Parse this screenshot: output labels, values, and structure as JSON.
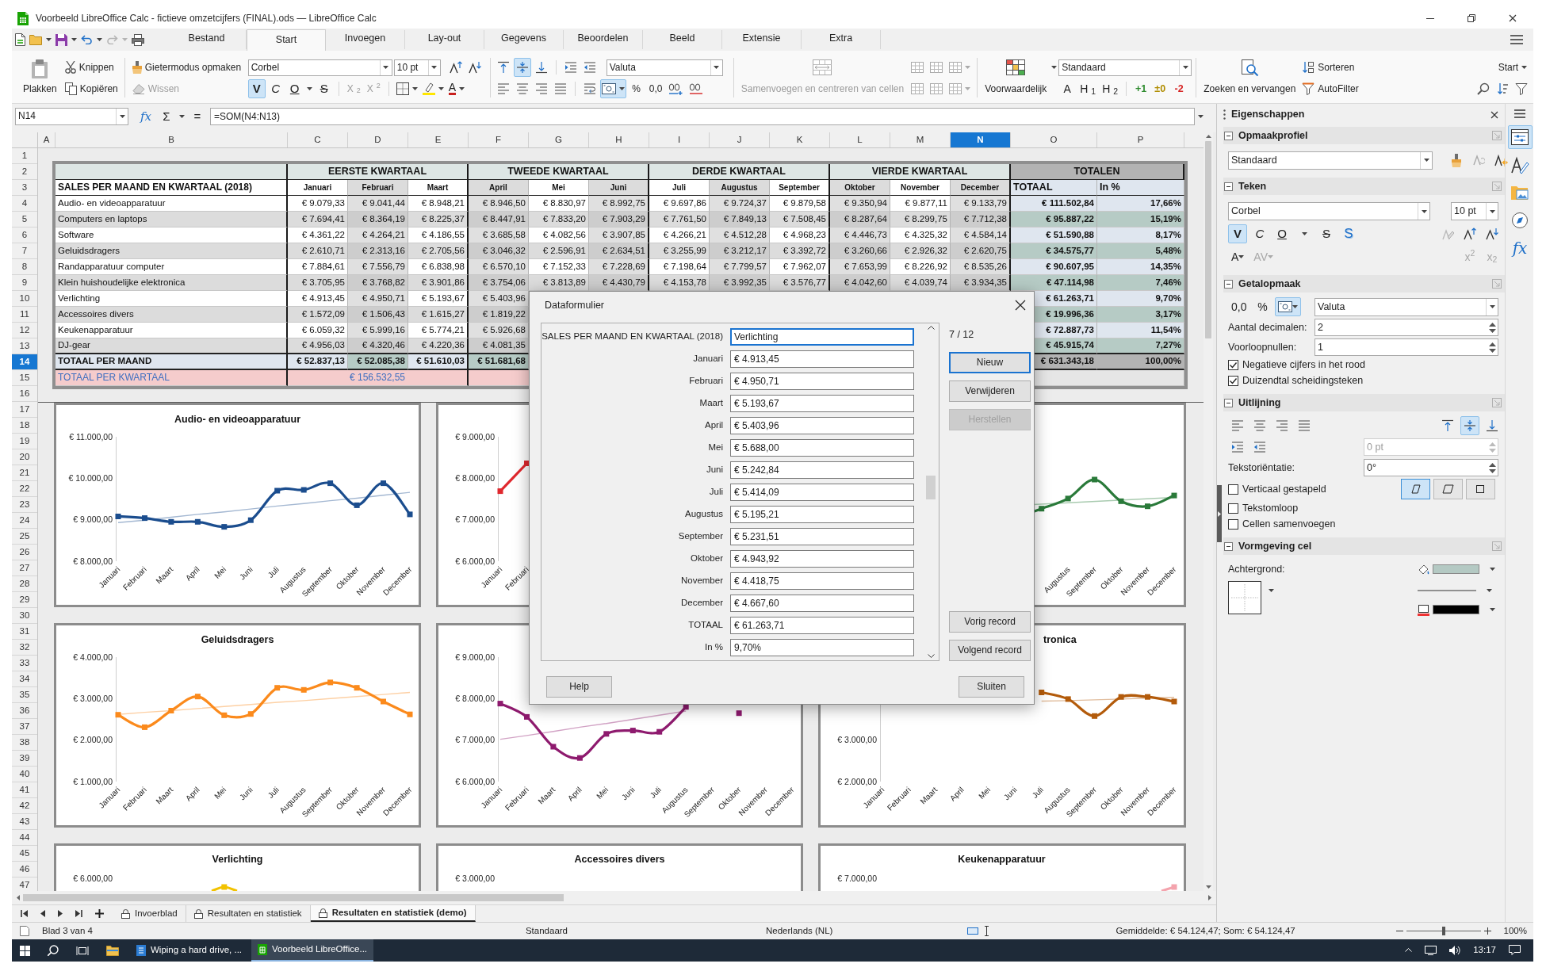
{
  "window": {
    "title": "Voorbeeld LibreOffice Calc - fictieve omzetcijfers (FINAL).ods — LibreOffice Calc"
  },
  "undo": {
    "disabled": false
  },
  "redo": {
    "disabled": true
  },
  "menu_tabs": [
    {
      "label": "Bestand",
      "selected": false
    },
    {
      "label": "Start",
      "selected": true
    },
    {
      "label": "Invoegen",
      "selected": false
    },
    {
      "label": "Lay-out",
      "selected": false
    },
    {
      "label": "Gegevens",
      "selected": false
    },
    {
      "label": "Beoordelen",
      "selected": false
    },
    {
      "label": "Beeld",
      "selected": false
    },
    {
      "label": "Extensie",
      "selected": false
    },
    {
      "label": "Extra",
      "selected": false
    }
  ],
  "ribbon": {
    "paste": "Plakken",
    "cut": "Knippen",
    "copy": "Kopiëren",
    "clone": "Gietermodus opmaken",
    "clear": {
      "label": "Wissen",
      "disabled": true
    },
    "font": "Corbel",
    "size": "10 pt",
    "styles": [
      {
        "label": "V",
        "on": true
      },
      {
        "label": "C",
        "on": false
      },
      {
        "label": "O",
        "on": false
      },
      {
        "label": "S",
        "on": false
      }
    ],
    "scripts": [
      {
        "label": "X$_{2}$",
        "disabled": true
      },
      {
        "label": "X$^{2}$",
        "disabled": true
      }
    ],
    "font_color": "A",
    "valign": [
      {
        "selected": false
      },
      {
        "selected": true
      },
      {
        "selected": false
      }
    ],
    "number_format": "Valuta",
    "currency": {
      "on": true
    },
    "number_symbols": [
      "%",
      "0,0"
    ],
    "merge": {
      "label": "Samenvoegen en centreren van cellen",
      "disabled": true
    },
    "conditional": "Voorwaardelijk",
    "cell_style": "Standaard",
    "style_glyphs": [
      "A",
      "H$_{1}$",
      "H$_{2}$"
    ],
    "quick_styles": [
      {
        "label": "+1",
        "color": "#2e8b2e"
      },
      {
        "label": "±0",
        "color": "#b08d00"
      },
      {
        "label": "-2",
        "color": "#d62424"
      }
    ],
    "find": "Zoeken en vervangen",
    "sort": "Sorteren",
    "filter": "AutoFilter",
    "tab_menu": "Start"
  },
  "formula_bar": {
    "cell": "N14",
    "function_wizard": "fx",
    "sum": "Σ",
    "equals": "=",
    "formula": "=SOM(N4:N13)"
  },
  "sheet": {
    "columns": [
      {
        "label": "A",
        "selected": false
      },
      {
        "label": "B",
        "selected": false
      },
      {
        "label": "C",
        "selected": false
      },
      {
        "label": "D",
        "selected": false
      },
      {
        "label": "E",
        "selected": false
      },
      {
        "label": "F",
        "selected": false
      },
      {
        "label": "G",
        "selected": false
      },
      {
        "label": "H",
        "selected": false
      },
      {
        "label": "I",
        "selected": false
      },
      {
        "label": "J",
        "selected": false
      },
      {
        "label": "K",
        "selected": false
      },
      {
        "label": "L",
        "selected": false
      },
      {
        "label": "M",
        "selected": false
      },
      {
        "label": "N",
        "selected": true
      },
      {
        "label": "O",
        "selected": false
      },
      {
        "label": "P",
        "selected": false
      }
    ],
    "rows": [
      {
        "label": "1",
        "selected": false
      },
      {
        "label": "2",
        "selected": false
      },
      {
        "label": "3",
        "selected": false
      },
      {
        "label": "4",
        "selected": false
      },
      {
        "label": "5",
        "selected": false
      },
      {
        "label": "6",
        "selected": false
      },
      {
        "label": "7",
        "selected": false
      },
      {
        "label": "8",
        "selected": false
      },
      {
        "label": "9",
        "selected": false
      },
      {
        "label": "10",
        "selected": false
      },
      {
        "label": "11",
        "selected": false
      },
      {
        "label": "12",
        "selected": false
      },
      {
        "label": "13",
        "selected": false
      },
      {
        "label": "14",
        "selected": true
      },
      {
        "label": "15",
        "selected": false
      },
      {
        "label": "16",
        "selected": false
      },
      {
        "label": "17",
        "selected": false
      },
      {
        "label": "18",
        "selected": false
      },
      {
        "label": "19",
        "selected": false
      },
      {
        "label": "20",
        "selected": false
      },
      {
        "label": "21",
        "selected": false
      },
      {
        "label": "22",
        "selected": false
      },
      {
        "label": "23",
        "selected": false
      },
      {
        "label": "24",
        "selected": false
      },
      {
        "label": "25",
        "selected": false
      },
      {
        "label": "26",
        "selected": false
      },
      {
        "label": "27",
        "selected": false
      },
      {
        "label": "28",
        "selected": false
      },
      {
        "label": "29",
        "selected": false
      },
      {
        "label": "30",
        "selected": false
      },
      {
        "label": "31",
        "selected": false
      },
      {
        "label": "32",
        "selected": false
      },
      {
        "label": "33",
        "selected": false
      },
      {
        "label": "34",
        "selected": false
      },
      {
        "label": "35",
        "selected": false
      },
      {
        "label": "36",
        "selected": false
      },
      {
        "label": "37",
        "selected": false
      },
      {
        "label": "38",
        "selected": false
      },
      {
        "label": "39",
        "selected": false
      },
      {
        "label": "40",
        "selected": false
      },
      {
        "label": "41",
        "selected": false
      },
      {
        "label": "42",
        "selected": false
      },
      {
        "label": "43",
        "selected": false
      },
      {
        "label": "44",
        "selected": false
      },
      {
        "label": "45",
        "selected": false
      },
      {
        "label": "46",
        "selected": false
      },
      {
        "label": "47",
        "selected": false
      }
    ],
    "table": {
      "group_headers": [
        {
          "kind": "quarter",
          "label": "EERSTE KWARTAAL"
        },
        {
          "kind": "quarter",
          "label": "TWEEDE KWARTAAL"
        },
        {
          "kind": "quarter",
          "label": "DERDE KWARTAAL"
        },
        {
          "kind": "quarter",
          "label": "VIERDE KWARTAAL"
        },
        {
          "kind": "totals",
          "label": "TOTALEN"
        }
      ],
      "title": "SALES PER MAAND EN KWARTAAL (2018)",
      "months": [
        "Januari",
        "Februari",
        "Maart",
        "April",
        "Mei",
        "Juni",
        "Juli",
        "Augustus",
        "September",
        "Oktober",
        "November",
        "December"
      ],
      "total_header": "TOTAAL",
      "percent_header": "In %",
      "rows": [
        {
          "label": "Audio- en videoapparatuur",
          "values": [
            "€ 9.079,33",
            "€ 9.041,44",
            "€ 8.948,21",
            "€ 8.946,50",
            "€ 8.830,97",
            "€ 8.992,75",
            "€ 9.697,86",
            "€ 9.724,37",
            "€ 9.879,58",
            "€ 9.350,94",
            "€ 9.877,11",
            "€ 9.133,79"
          ],
          "total": "€ 111.502,84",
          "percent": "17,66%"
        },
        {
          "label": "Computers en laptops",
          "values": [
            "€ 7.694,41",
            "€ 8.364,19",
            "€ 8.225,37",
            "€ 8.447,91",
            "€ 7.833,20",
            "€ 7.903,29",
            "€ 7.761,50",
            "€ 7.849,13",
            "€ 7.508,45",
            "€ 8.287,64",
            "€ 8.299,75",
            "€ 7.712,38"
          ],
          "total": "€ 95.887,22",
          "percent": "15,19%"
        },
        {
          "label": "Software",
          "values": [
            "€ 4.361,22",
            "€ 4.264,21",
            "€ 4.186,55",
            "€ 3.685,58",
            "€ 4.082,56",
            "€ 3.907,85",
            "€ 4.266,21",
            "€ 4.512,28",
            "€ 4.968,23",
            "€ 4.446,73",
            "€ 4.325,32",
            "€ 4.584,14"
          ],
          "total": "€ 51.590,88",
          "percent": "8,17%"
        },
        {
          "label": "Geluidsdragers",
          "values": [
            "€ 2.610,71",
            "€ 2.313,16",
            "€ 2.705,56",
            "€ 3.046,32",
            "€ 2.596,91",
            "€ 2.634,51",
            "€ 3.255,99",
            "€ 3.212,17",
            "€ 3.392,72",
            "€ 3.260,66",
            "€ 2.926,32",
            "€ 2.620,75"
          ],
          "total": "€ 34.575,77",
          "percent": "5,48%"
        },
        {
          "label": "Randapparatuur computer",
          "values": [
            "€ 7.884,61",
            "€ 7.556,79",
            "€ 6.838,98",
            "€ 6.570,10",
            "€ 7.152,33",
            "€ 7.228,69",
            "€ 7.198,64",
            "€ 7.799,57",
            "€ 7.962,07",
            "€ 7.653,99",
            "€ 8.226,92",
            "€ 8.535,26"
          ],
          "total": "€ 90.607,95",
          "percent": "14,35%"
        },
        {
          "label": "Klein huishoudelijke elektronica",
          "values": [
            "€ 3.705,95",
            "€ 3.768,82",
            "€ 3.901,86",
            "€ 3.754,06",
            "€ 3.813,89",
            "€ 4.430,79",
            "€ 4.153,78",
            "€ 3.992,35",
            "€ 3.576,77",
            "€ 4.042,60",
            "€ 4.039,74",
            "€ 3.934,35"
          ],
          "total": "€ 47.114,98",
          "percent": "7,46%"
        },
        {
          "label": "Verlichting",
          "values": [
            "€ 4.913,45",
            "€ 4.950,71",
            "€ 5.193,67",
            "€ 5.403,96"
          ],
          "total": "€ 61.263,71",
          "percent": "9,70%"
        },
        {
          "label": "Accessoires divers",
          "values": [
            "€ 1.572,09",
            "€ 1.506,43",
            "€ 1.615,27",
            "€ 1.819,22"
          ],
          "total": "€ 19.996,36",
          "percent": "3,17%"
        },
        {
          "label": "Keukenapparatuur",
          "values": [
            "€ 6.059,32",
            "€ 5.999,16",
            "€ 5.774,21",
            "€ 5.926,68"
          ],
          "total": "€ 72.887,73",
          "percent": "11,54%"
        },
        {
          "label": "DJ-gear",
          "values": [
            "€ 4.956,03",
            "€ 4.320,46",
            "€ 4.220,36",
            "€ 4.081,35"
          ],
          "total": "€ 45.915,74",
          "percent": "7,27%"
        }
      ],
      "total_row": {
        "label": "TOTAAL PER MAAND",
        "values": [
          "€ 52.837,13",
          "€ 52.085,38",
          "€ 51.610,03",
          "€ 51.681,68"
        ],
        "total": "€ 631.343,18",
        "percent": "100,00%"
      },
      "quarter_row": {
        "label": "TOTAAL PER KWARTAAL",
        "values": [
          "€ 156.532,55"
        ]
      }
    },
    "charts": [
      {
        "kind": "line",
        "title_clipped": false,
        "chart_data": {
          "type": "line",
          "title": "Audio- en videoapparatuur",
          "categories": [
            "Januari",
            "Februari",
            "Maart",
            "April",
            "Mei",
            "Juni",
            "Juli",
            "Augustus",
            "September",
            "Oktober",
            "November",
            "December"
          ],
          "series": [
            {
              "color": "#1b4d8e",
              "marker": "square",
              "values": [
                9080,
                9040,
                8950,
                8950,
                8830,
                8990,
                9700,
                9720,
                9880,
                9350,
                9880,
                9130
              ]
            },
            {
              "color": "#a4b8d2",
              "values": [
                8930,
                8990,
                9060,
                9130,
                9190,
                9260,
                9330,
                9390,
                9460,
                9520,
                9590,
                9660
              ]
            }
          ],
          "ylim": [
            8000,
            11000
          ],
          "yticks": [
            {
              "value": 8000,
              "label": "€ 8.000,00"
            },
            {
              "value": 9000,
              "label": "€ 9.000,00"
            },
            {
              "value": 10000,
              "label": "€ 10.000,00"
            },
            {
              "value": 11000,
              "label": "€ 11.000,00"
            }
          ]
        }
      },
      {
        "kind": "line",
        "chart_data": {
          "type": "line",
          "categories": [
            "Januari",
            "Februari",
            null,
            null,
            null,
            null,
            null,
            null,
            null,
            null,
            null,
            null
          ],
          "series": [
            {
              "color": "#e0282e",
              "marker": "square",
              "values": [
                7690,
                8360,
                null,
                null,
                null,
                null,
                null,
                null,
                null,
                null,
                null,
                null
              ]
            }
          ],
          "ylim": [
            6000,
            9000
          ],
          "yticks": [
            {
              "value": 6000,
              "label": "€ 6.000,00"
            },
            {
              "value": 7000,
              "label": "€ 7.000,00"
            },
            {
              "value": 8000,
              "label": "€ 8.000,00"
            },
            {
              "value": 9000,
              "label": "€ 9.000,00"
            }
          ]
        }
      },
      {
        "kind": "picture",
        "categories": [
          "Augustus",
          "September",
          "Oktober",
          "November",
          "December"
        ]
      },
      {
        "kind": "line",
        "title_clipped": false,
        "chart_data": {
          "type": "line",
          "title": "Geluidsdragers",
          "categories": [
            "Januari",
            "Februari",
            "Maart",
            "April",
            "Mei",
            "Juni",
            "Juli",
            "Augustus",
            "September",
            "Oktober",
            "November",
            "December"
          ],
          "series": [
            {
              "color": "#fb8a1c",
              "marker": "square",
              "values": [
                2610,
                2310,
                2710,
                3050,
                2600,
                2630,
                3260,
                3210,
                3390,
                3260,
                2930,
                2620
              ]
            },
            {
              "color": "#fdd0a4",
              "values": [
                2620,
                2670,
                2710,
                2760,
                2810,
                2860,
                2910,
                2950,
                3000,
                3050,
                3100,
                3150
              ]
            }
          ],
          "ylim": [
            1000,
            4000
          ],
          "yticks": [
            {
              "value": 1000,
              "label": "€ 1.000,00"
            },
            {
              "value": 2000,
              "label": "€ 2.000,00"
            },
            {
              "value": 3000,
              "label": "€ 3.000,00"
            },
            {
              "value": 4000,
              "label": "€ 4.000,00"
            }
          ]
        }
      },
      {
        "kind": "line",
        "chart_data": {
          "type": "line",
          "categories": [
            "Januari",
            "Februari",
            "Maart",
            "April",
            "Mei",
            "Juni",
            "Juli",
            "Augustus",
            "September",
            "Oktober",
            "November",
            "December"
          ],
          "series": [
            {
              "color": "#8e1a6e",
              "marker": "square",
              "values": [
                7880,
                7560,
                6840,
                6570,
                7150,
                7230,
                7200,
                7800,
                null,
                7650,
                null,
                null
              ]
            },
            {
              "color": "#d2a3c5",
              "values": [
                7020,
                7110,
                7210,
                7310,
                7400,
                7500,
                7600,
                7700,
                null,
                null,
                null,
                null
              ]
            }
          ],
          "ylim": [
            6000,
            9000
          ],
          "yticks": [
            {
              "value": 6000,
              "label": "€ 6.000,00"
            },
            {
              "value": 7000,
              "label": "€ 7.000,00"
            },
            {
              "value": 8000,
              "label": "€ 8.000,00"
            },
            {
              "value": 9000,
              "label": "€ 9.000,00"
            }
          ]
        }
      },
      {
        "kind": "line",
        "title_clipped": true,
        "chart_data": {
          "type": "line",
          "title": "tronica",
          "categories": [
            "Januari",
            "Februari",
            "Maart",
            "April",
            "Mei",
            "Juni",
            "Juli",
            "Augustus",
            "September",
            "Oktober",
            "November",
            "December"
          ],
          "series": [
            {
              "color": "#b35b0b",
              "marker": "square",
              "values": [
                null,
                null,
                null,
                null,
                null,
                null,
                4150,
                3990,
                3580,
                4040,
                4040,
                3930
              ]
            },
            {
              "color": "#e1bd9d",
              "values": [
                null,
                null,
                null,
                null,
                null,
                null,
                3940,
                3950,
                3970,
                3990,
                4010,
                4030
              ]
            }
          ],
          "ylim": [
            2000,
            5000
          ],
          "yticks": [
            {
              "value": 2000,
              "label": "€ 2.000,00"
            },
            {
              "value": 3000,
              "label": "€ 3.000,00"
            }
          ]
        }
      },
      {
        "kind": "picture",
        "title": "Verlichting",
        "tick_label": "€ 6.000,00"
      },
      {
        "kind": "picture",
        "title": "Accessoires divers",
        "tick_label": "€ 3.000,00"
      },
      {
        "kind": "picture",
        "title": "Keukenapparatuur",
        "tick_label": "€ 7.000,00"
      }
    ]
  },
  "dialog": {
    "title": "Dataformulier",
    "record": "7 / 12",
    "fields": [
      {
        "label": "SALES PER MAAND EN KWARTAAL (2018)",
        "value": "Verlichting",
        "focused": true
      },
      {
        "label": "Januari",
        "value": "€ 4.913,45",
        "focused": false
      },
      {
        "label": "Februari",
        "value": "€ 4.950,71",
        "focused": false
      },
      {
        "label": "Maart",
        "value": "€ 5.193,67",
        "focused": false
      },
      {
        "label": "April",
        "value": "€ 5.403,96",
        "focused": false
      },
      {
        "label": "Mei",
        "value": "€ 5.688,00",
        "focused": false
      },
      {
        "label": "Juni",
        "value": "€ 5.242,84",
        "focused": false
      },
      {
        "label": "Juli",
        "value": "€ 5.414,09",
        "focused": false
      },
      {
        "label": "Augustus",
        "value": "€ 5.195,21",
        "focused": false
      },
      {
        "label": "September",
        "value": "€ 5.231,51",
        "focused": false
      },
      {
        "label": "Oktober",
        "value": "€ 4.943,92",
        "focused": false
      },
      {
        "label": "November",
        "value": "€ 4.418,75",
        "focused": false
      },
      {
        "label": "December",
        "value": "€ 4.667,60",
        "focused": false
      },
      {
        "label": "TOTAAL",
        "value": "€ 61.263,71",
        "focused": false
      },
      {
        "label": "In %",
        "value": "9,70%",
        "focused": false
      }
    ],
    "buttons": [
      {
        "label": "Nieuw",
        "default": true,
        "disabled": false
      },
      {
        "label": "Verwijderen",
        "default": false,
        "disabled": false
      },
      {
        "label": "Herstellen",
        "default": false,
        "disabled": true
      }
    ],
    "nav_buttons": [
      "Vorig record",
      "Volgend record"
    ],
    "footer_buttons": [
      "Help",
      "Sluiten"
    ]
  },
  "sidebar": {
    "title": "Eigenschappen",
    "deck": [
      {
        "kind": "properties",
        "selected": true
      },
      {
        "kind": "styles",
        "selected": false
      },
      {
        "kind": "gallery",
        "selected": false
      },
      {
        "kind": "navigator",
        "selected": false
      },
      {
        "kind": "functions",
        "label": "fx",
        "selected": false
      }
    ],
    "sections": [
      {
        "kind": "style",
        "title": "Opmaakprofiel",
        "value": "Standaard"
      },
      {
        "kind": "character",
        "title": "Teken",
        "font": "Corbel",
        "size": "10 pt",
        "styles": [
          {
            "label": "V",
            "on": true
          },
          {
            "label": "C",
            "on": false
          },
          {
            "label": "O",
            "on": false
          },
          {
            "label": "S",
            "on": false
          },
          {
            "label": "S",
            "on": false
          }
        ],
        "font_color": "A",
        "spacing": "AV",
        "scripts": [
          "x$^{2}$",
          "x$_{2}$"
        ]
      },
      {
        "kind": "number",
        "title": "Getalopmaak",
        "symbols": [
          "0,0",
          "%"
        ],
        "currency_on": true,
        "format": "Valuta",
        "fields": [
          {
            "label": "Aantal decimalen:",
            "value": "2"
          },
          {
            "label": "Voorloopnullen:",
            "value": "1"
          }
        ],
        "options": [
          {
            "label": "Negatieve cijfers in het rood",
            "checked": true
          },
          {
            "label": "Duizendtal scheidingsteken",
            "checked": true
          }
        ]
      },
      {
        "kind": "alignment",
        "title": "Uitlijning",
        "halign": [
          {
            "selected": false
          },
          {
            "selected": false
          },
          {
            "selected": false
          },
          {
            "selected": false
          }
        ],
        "valign": [
          {
            "selected": false
          },
          {
            "selected": true
          },
          {
            "selected": false
          }
        ],
        "indent": {
          "value": "0 pt",
          "disabled": true
        },
        "orientation_label": "Tekstoriëntatie:",
        "orientation": "0°",
        "stacking": [
          {
            "selected": true
          },
          {
            "selected": false
          },
          {
            "selected": false
          }
        ],
        "options": [
          {
            "label": "Verticaal gestapeld",
            "checked": false
          },
          {
            "label": "Tekstomloop",
            "checked": false
          },
          {
            "label": "Cellen samenvoegen",
            "checked": false
          }
        ]
      },
      {
        "kind": "cell",
        "title": "Vormgeving cel",
        "background_label": "Achtergrond:"
      }
    ]
  },
  "sheet_tabs": [
    {
      "label": "Invoerblad",
      "selected": false
    },
    {
      "label": "Resultaten en statistiek",
      "selected": false
    },
    {
      "label": "Resultaten en statistiek (demo)",
      "selected": true
    }
  ],
  "status_bar": {
    "sheet": "Blad 3 van 4",
    "style": "Standaard",
    "language": "Nederlands (NL)",
    "summary": "Gemiddelde: € 54.124,47; Som: € 54.124,47",
    "zoom": {
      "level": 0.5,
      "label": "100%"
    }
  },
  "taskbar": {
    "apps": [
      {
        "label": "Wiping a hard drive, ...",
        "selected": false
      },
      {
        "label": "Voorbeeld LibreOffice...",
        "selected": true
      }
    ],
    "time": "13:17"
  }
}
